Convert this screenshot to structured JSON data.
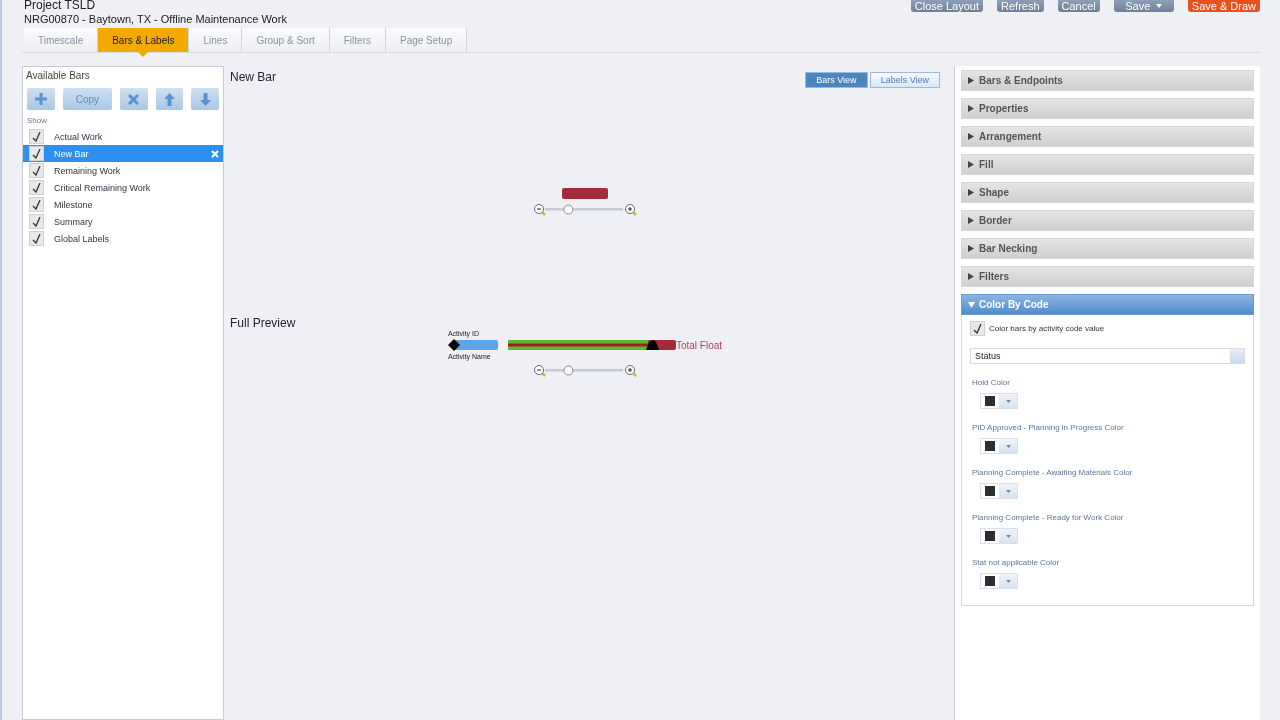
{
  "header": {
    "title": "Project TSLD",
    "subtitle": "NRG00870 - Baytown, TX - Offline Maintenance Work"
  },
  "actions": [
    {
      "label": "Close Layout",
      "kind": "plain"
    },
    {
      "label": "Refresh",
      "kind": "plain"
    },
    {
      "label": "Cancel",
      "kind": "plain"
    },
    {
      "label": "Save",
      "kind": "split"
    },
    {
      "label": "Save & Draw",
      "kind": "primary"
    }
  ],
  "tabs": [
    {
      "label": "Timescale",
      "selected": false
    },
    {
      "label": "Bars & Labels",
      "selected": true
    },
    {
      "label": "Lines",
      "selected": false
    },
    {
      "label": "Group & Sort",
      "selected": false
    },
    {
      "label": "Filters",
      "selected": false
    },
    {
      "label": "Page Setup",
      "selected": false
    }
  ],
  "available_bars": {
    "title": "Available Bars",
    "toolbar": [
      {
        "kind": "add"
      },
      {
        "kind": "copy",
        "label": "Copy"
      },
      {
        "kind": "delete"
      },
      {
        "kind": "up"
      },
      {
        "kind": "down"
      }
    ],
    "show_label": "Show",
    "items": [
      {
        "label": "Actual Work",
        "checked": true,
        "selected": false
      },
      {
        "label": "New Bar",
        "checked": true,
        "selected": true
      },
      {
        "label": "Remaining Work",
        "checked": true,
        "selected": false
      },
      {
        "label": "Critical Remaining Work",
        "checked": true,
        "selected": false
      },
      {
        "label": "Milestone",
        "checked": true,
        "selected": false
      },
      {
        "label": "Summary",
        "checked": true,
        "selected": false
      },
      {
        "label": "Global Labels",
        "checked": true,
        "selected": false
      }
    ]
  },
  "bar_preview": {
    "title": "New Bar",
    "views": [
      {
        "label": "Bars View",
        "selected": true
      },
      {
        "label": "Labels View",
        "selected": false
      }
    ],
    "zoom": {
      "level": 0.3
    }
  },
  "full_preview": {
    "title": "Full Preview",
    "label_top": "Activity ID",
    "label_bottom": "Activity Name",
    "float_label": "Total Float",
    "zoom": {
      "level": 0.3
    }
  },
  "sections": [
    {
      "label": "Bars & Endpoints",
      "expanded": false
    },
    {
      "label": "Properties",
      "expanded": false
    },
    {
      "label": "Arrangement",
      "expanded": false
    },
    {
      "label": "Fill",
      "expanded": false
    },
    {
      "label": "Shape",
      "expanded": false
    },
    {
      "label": "Border",
      "expanded": false
    },
    {
      "label": "Bar Necking",
      "expanded": false
    },
    {
      "label": "Filters",
      "expanded": false
    },
    {
      "label": "Color By Code",
      "expanded": true
    }
  ],
  "color_by_code": {
    "option": {
      "label": "Color bars by activity code value",
      "checked": true
    },
    "code_field": {
      "value": "Status"
    },
    "colors": [
      {
        "label": "Hold Color",
        "color": "#2b2e33"
      },
      {
        "label": "PID Approved - Planning in Progress Color",
        "color": "#2b2e33"
      },
      {
        "label": "Planning Complete - Awaiting Materials Color",
        "color": "#2b2e33"
      },
      {
        "label": "Planning Complete - Ready for Work Color",
        "color": "#2b2e33"
      },
      {
        "label": "Stat not applicable Color",
        "color": "#2b2e33"
      }
    ]
  }
}
